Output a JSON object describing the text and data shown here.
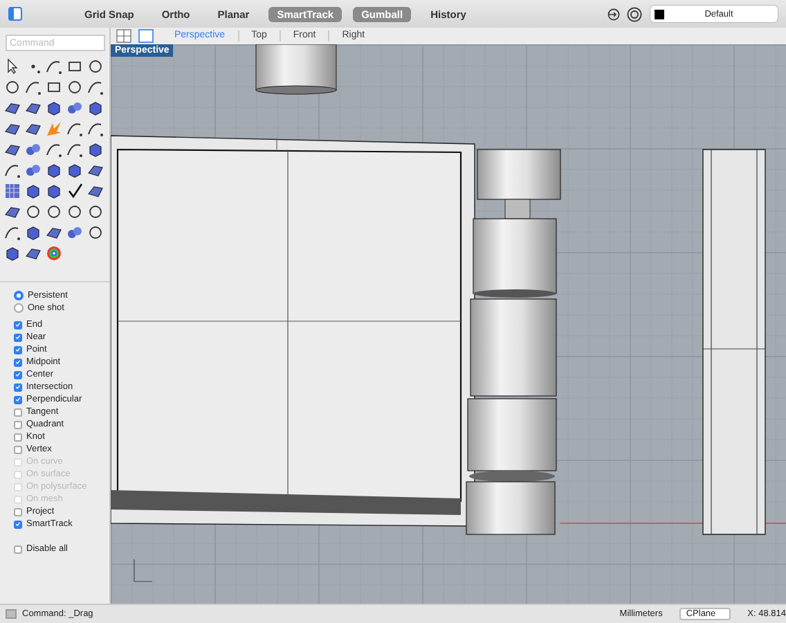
{
  "toolbar": {
    "buttons": [
      {
        "label": "Grid Snap",
        "on": false
      },
      {
        "label": "Ortho",
        "on": false
      },
      {
        "label": "Planar",
        "on": false
      },
      {
        "label": "SmartTrack",
        "on": true
      },
      {
        "label": "Gumball",
        "on": true
      },
      {
        "label": "History",
        "on": false
      }
    ],
    "layer": "Default"
  },
  "view_tabs": [
    {
      "label": "Perspective",
      "selected": true
    },
    {
      "label": "Top",
      "selected": false
    },
    {
      "label": "Front",
      "selected": false
    },
    {
      "label": "Right",
      "selected": false
    }
  ],
  "command": {
    "placeholder": "Command"
  },
  "viewport": {
    "label": "Perspective"
  },
  "snap_mode": [
    {
      "label": "Persistent",
      "selected": true
    },
    {
      "label": "One shot",
      "selected": false
    }
  ],
  "osnaps": [
    {
      "label": "End",
      "checked": true,
      "disabled": false
    },
    {
      "label": "Near",
      "checked": true,
      "disabled": false
    },
    {
      "label": "Point",
      "checked": true,
      "disabled": false
    },
    {
      "label": "Midpoint",
      "checked": true,
      "disabled": false
    },
    {
      "label": "Center",
      "checked": true,
      "disabled": false
    },
    {
      "label": "Intersection",
      "checked": true,
      "disabled": false
    },
    {
      "label": "Perpendicular",
      "checked": true,
      "disabled": false
    },
    {
      "label": "Tangent",
      "checked": false,
      "disabled": false
    },
    {
      "label": "Quadrant",
      "checked": false,
      "disabled": false
    },
    {
      "label": "Knot",
      "checked": false,
      "disabled": false
    },
    {
      "label": "Vertex",
      "checked": false,
      "disabled": false
    },
    {
      "label": "On curve",
      "checked": false,
      "disabled": true
    },
    {
      "label": "On surface",
      "checked": false,
      "disabled": true
    },
    {
      "label": "On polysurface",
      "checked": false,
      "disabled": true
    },
    {
      "label": "On mesh",
      "checked": false,
      "disabled": true
    },
    {
      "label": "Project",
      "checked": false,
      "disabled": false
    },
    {
      "label": "SmartTrack",
      "checked": true,
      "disabled": false
    }
  ],
  "disable_all": {
    "label": "Disable all",
    "checked": false
  },
  "status": {
    "command": "Command: _Drag",
    "units": "Millimeters",
    "cplane": "CPlane",
    "coordinate": "X: 48.814"
  }
}
